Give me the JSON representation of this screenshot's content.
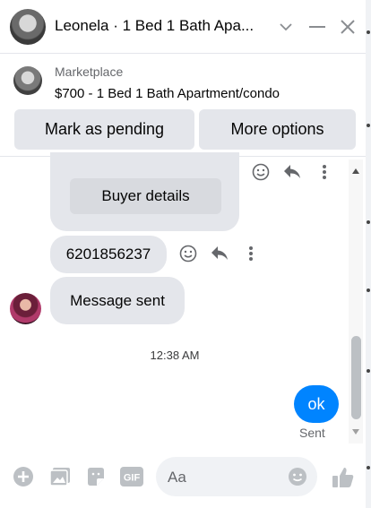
{
  "header": {
    "title": "Leonela · 1 Bed 1 Bath Apa...",
    "icons": [
      "chevron-down-icon",
      "minimize-icon",
      "close-icon"
    ]
  },
  "listing": {
    "source": "Marketplace",
    "description": "$700 - 1 Bed 1 Bath Apartment/condo",
    "pending_label": "Mark as pending",
    "options_label": "More options"
  },
  "messages": {
    "buyer_details_label": "Buyer details",
    "phone": "6201856237",
    "message_sent": "Message sent",
    "timestamp": "12:38 AM",
    "outgoing": "ok",
    "outgoing_status": "Sent"
  },
  "composer": {
    "placeholder": "Aa",
    "icons": [
      "plus-icon",
      "image-icon",
      "sticker-icon",
      "gif-icon",
      "emoji-icon",
      "thumbs-up-icon"
    ],
    "gif_text": "GIF"
  },
  "colors": {
    "accent": "#0084ff",
    "icon": "#0084ff",
    "bubble": "#e4e6eb"
  }
}
